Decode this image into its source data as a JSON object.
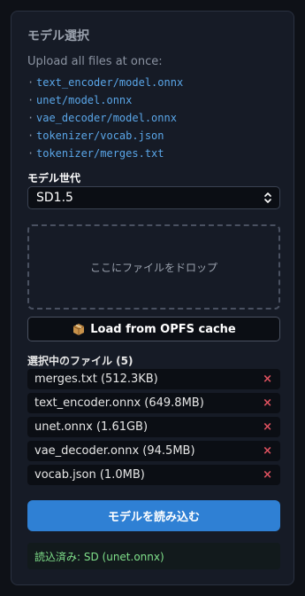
{
  "panel": {
    "title": "モデル選択",
    "upload_hint": "Upload all files at once:",
    "required_files": [
      "text_encoder/model.onnx",
      "unet/model.onnx",
      "vae_decoder/model.onnx",
      "tokenizer/vocab.json",
      "tokenizer/merges.txt"
    ],
    "bullet": "·"
  },
  "generation": {
    "label": "モデル世代",
    "selected": "SD1.5"
  },
  "dropzone": {
    "text": "ここにファイルをドロップ"
  },
  "opfs_button": {
    "label": "Load from OPFS cache",
    "icon": "package-icon"
  },
  "selected_files": {
    "label": "選択中のファイル (5)",
    "items": [
      {
        "name": "merges.txt (512.3KB)"
      },
      {
        "name": "text_encoder.onnx (649.8MB)"
      },
      {
        "name": "unet.onnx (1.61GB)"
      },
      {
        "name": "vae_decoder.onnx (94.5MB)"
      },
      {
        "name": "vocab.json (1.0MB)"
      }
    ],
    "remove_glyph": "×"
  },
  "load_button": {
    "label": "モデルを読み込む"
  },
  "status": {
    "text": "読込済み: SD (unet.onnx)"
  },
  "colors": {
    "accent": "#2f80d4",
    "link": "#5aa6e8",
    "remove": "#e05260",
    "success": "#7fe08a"
  }
}
